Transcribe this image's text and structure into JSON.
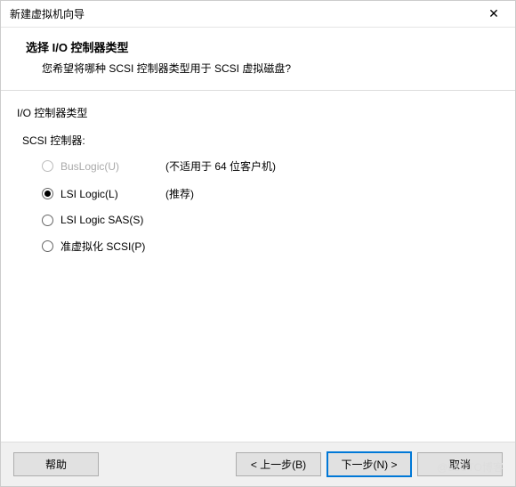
{
  "window": {
    "title": "新建虚拟机向导"
  },
  "header": {
    "title": "选择 I/O 控制器类型",
    "subtitle": "您希望将哪种 SCSI 控制器类型用于 SCSI 虚拟磁盘?"
  },
  "group": {
    "label": "I/O 控制器类型",
    "sub_label": "SCSI 控制器:",
    "options": [
      {
        "label": "BusLogic(U)",
        "note": "(不适用于 64 位客户机)",
        "selected": false,
        "disabled": true
      },
      {
        "label": "LSI Logic(L)",
        "note": "(推荐)",
        "selected": true,
        "disabled": false
      },
      {
        "label": "LSI Logic SAS(S)",
        "note": "",
        "selected": false,
        "disabled": false
      },
      {
        "label": "准虚拟化 SCSI(P)",
        "note": "",
        "selected": false,
        "disabled": false
      }
    ]
  },
  "buttons": {
    "help": "帮助",
    "back": "< 上一步(B)",
    "next": "下一步(N) >",
    "cancel": "取消"
  },
  "watermark": "@51CTO博客"
}
